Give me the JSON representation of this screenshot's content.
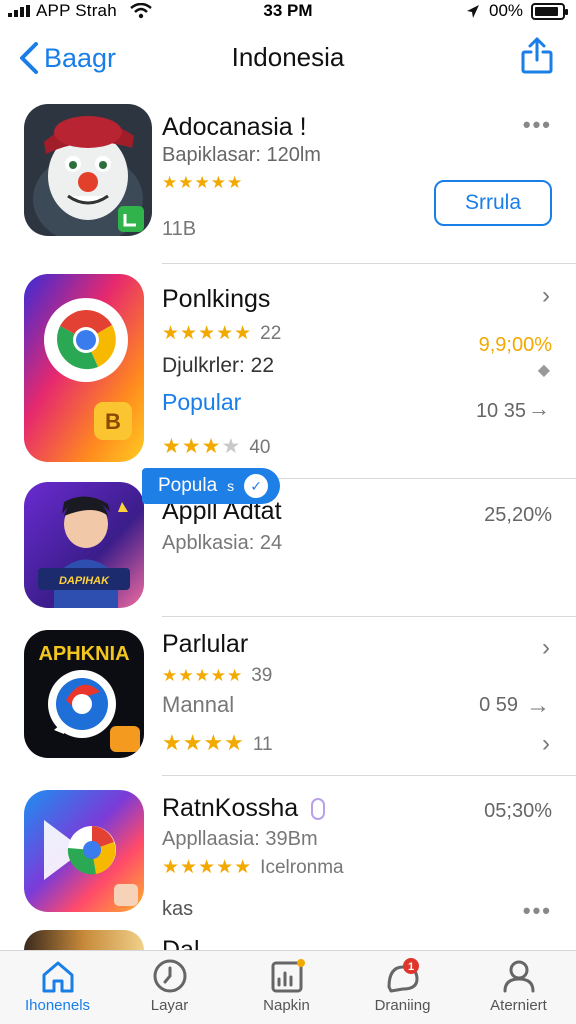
{
  "status_bar": {
    "carrier": "APP Strah",
    "time": "33 PM",
    "battery_pct": "00%",
    "battery_level": 0.9
  },
  "nav": {
    "back_label": "Baagr",
    "title": "Indonesia"
  },
  "apps": [
    {
      "name": "Adocanasia !",
      "subtitle": "Bapiklasar: 120lm",
      "stars": 5,
      "extra": "11B",
      "get_label": "Srrula"
    },
    {
      "name": "Ponlkings",
      "stars_a": 5,
      "stars_a_count": "22",
      "right_a": "9,9;00%",
      "subtitle": "Djulkrler: 22",
      "popular": "Popular",
      "right_b": "10  35",
      "stars_b": 3,
      "stars_b_count": "40"
    },
    {
      "name": "Appll Adtat",
      "right": "25,20%",
      "subtitle": "Apblkasia: 24",
      "popular_chip": "Popula",
      "chip_arrow": "s",
      "icon_text": "DAPIHAK"
    },
    {
      "name": "Parlular",
      "stars_a": 5,
      "stars_a_count": "39",
      "subtitle": "Mannal",
      "right_b": "0  59",
      "stars_b": 4,
      "stars_b_count": "11",
      "icon_text": "APHKNIA"
    },
    {
      "name": "RatnKossha",
      "right": "05;30%",
      "subtitle": "Appllaasia: 39Bm",
      "stars": 5,
      "stars_text": "Icelronma",
      "extra": "kas"
    }
  ],
  "next_row_partial_name": "Dal",
  "tabs": [
    {
      "label": "Ihonenels",
      "icon": "home-icon",
      "active": true
    },
    {
      "label": "Layar",
      "icon": "clock-icon",
      "active": false
    },
    {
      "label": "Napkin",
      "icon": "chart-icon",
      "active": false
    },
    {
      "label": "Draniing",
      "icon": "chat-icon",
      "active": false
    },
    {
      "label": "Aterniert",
      "icon": "person-icon",
      "active": false
    }
  ],
  "tab_badge": "1",
  "colors": {
    "accent": "#1a7ee8",
    "star": "#f2a900",
    "percent_highlight": "#f2a900"
  }
}
